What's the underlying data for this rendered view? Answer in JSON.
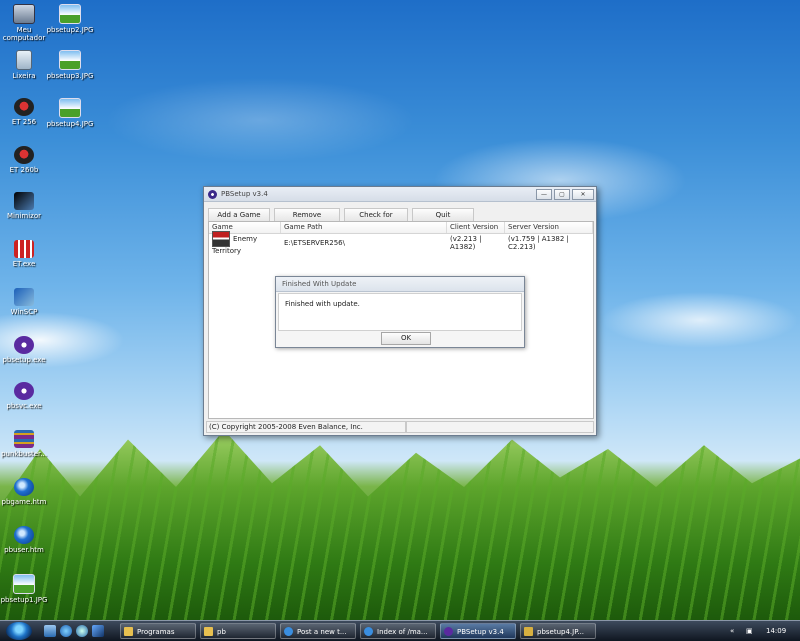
{
  "desktop": {
    "icons": [
      {
        "label": "Meu computador",
        "icon": "computer-icon"
      },
      {
        "label": "pbsetup2.JPG",
        "icon": "image-file-icon"
      },
      {
        "label": "Lixeira",
        "icon": "recycle-bin-icon"
      },
      {
        "label": "pbsetup3.JPG",
        "icon": "image-file-icon"
      },
      {
        "label": "ET 256",
        "icon": "et-game-icon"
      },
      {
        "label": "pbsetup4.JPG",
        "icon": "image-file-icon"
      },
      {
        "label": "ET 260b",
        "icon": "et-game-icon"
      },
      {
        "label": "Minimizor",
        "icon": "app-icon"
      },
      {
        "label": "ET.exe",
        "icon": "exe-icon"
      },
      {
        "label": "WinSCP",
        "icon": "winscp-icon"
      },
      {
        "label": "pbsetup.exe",
        "icon": "punkbuster-icon"
      },
      {
        "label": "pbsvc.exe",
        "icon": "punkbuster-icon"
      },
      {
        "label": "punkbuster...",
        "icon": "rar-archive-icon"
      },
      {
        "label": "pbgame.htm",
        "icon": "html-file-icon"
      },
      {
        "label": "pbuser.htm",
        "icon": "html-file-icon"
      },
      {
        "label": "pbsetup1.JPG",
        "icon": "image-file-icon"
      }
    ]
  },
  "window": {
    "title": "PBSetup v3.4",
    "controls": {
      "minimize": "—",
      "maximize": "▢",
      "close": "✕"
    },
    "toolbar": {
      "add_game": "Add a Game",
      "remove_game": "Remove Game",
      "check_updates": "Check for Updates",
      "quit": "Quit"
    },
    "list": {
      "columns": [
        "Game",
        "Game Path",
        "Client Version",
        "Server Version"
      ],
      "rows": [
        {
          "game": "Enemy Territory",
          "path": "E:\\ETSERVER256\\",
          "client": "(v2.213 | A1382)",
          "server": "(v1.759 | A1382 | C2.213)"
        }
      ]
    },
    "status": "(C) Copyright 2005-2008 Even Balance, Inc."
  },
  "dialog": {
    "title": "Finished With Update",
    "message": "Finished with update.",
    "ok": "OK"
  },
  "taskbar": {
    "tasks": [
      {
        "label": "Programas",
        "color": "#e8c050"
      },
      {
        "label": "pb",
        "color": "#e8c050"
      },
      {
        "label": "Post a new t...",
        "color": "#3a8ee0"
      },
      {
        "label": "Index of /ma...",
        "color": "#3a8ee0"
      },
      {
        "label": "PBSetup v3.4",
        "color": "#5a2aa0"
      },
      {
        "label": "pbsetup4.JP...",
        "color": "#d8b040"
      }
    ],
    "clock": "14:09"
  }
}
